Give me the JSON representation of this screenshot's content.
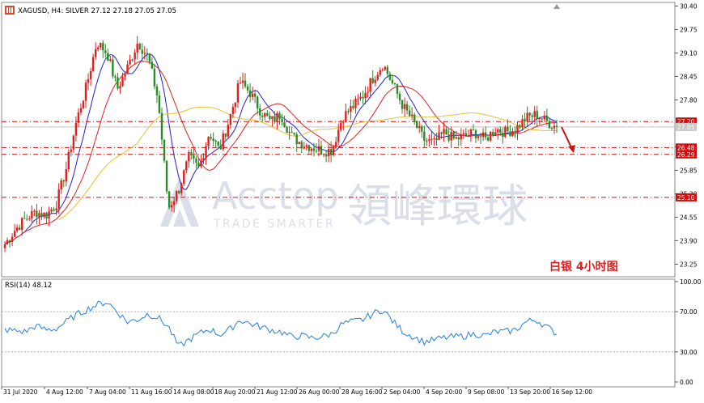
{
  "header": {
    "symbol_line": "XAGUSD, H4:  SILVER  27.12 27.18 27.05 27.05"
  },
  "rsi_header": {
    "label": "RSI(14) 48.12"
  },
  "watermark": {
    "brand": "Acctop",
    "chinese": "領峰環球",
    "tagline": "TRADE SMARTER"
  },
  "annotation": {
    "text": "白银   4小时图",
    "color": "#e02020"
  },
  "colors": {
    "bull": "#e02020",
    "bear": "#2a8a2a",
    "ma_fast": "#2020d0",
    "ma_mid": "#e02020",
    "ma_slow": "#e8c030",
    "level_line": "#d01010",
    "rsi_line": "#2080e0",
    "price_bg": "#d01010"
  },
  "chart_data": [
    {
      "type": "candlestick",
      "ylim": [
        22.9,
        30.5
      ],
      "y_ticks": [
        30.4,
        29.75,
        29.1,
        28.45,
        27.8,
        26.5,
        25.85,
        25.2,
        24.55,
        23.9,
        23.25
      ],
      "x_ticks": [
        "31 Jul 2020",
        "4 Aug 12:00",
        "7 Aug 04:00",
        "11 Aug 16:00",
        "14 Aug 08:00",
        "18 Aug 20:00",
        "21 Aug 12:00",
        "26 Aug 00:00",
        "28 Aug 16:00",
        "2 Sep 04:00",
        "4 Sep 20:00",
        "9 Sep 08:00",
        "13 Sep 20:00",
        "16 Sep 12:00"
      ],
      "levels": [
        {
          "value": 27.2,
          "label": "27.20"
        },
        {
          "value": 26.48,
          "label": "26.48"
        },
        {
          "value": 26.29,
          "label": "26.29"
        },
        {
          "value": 25.1,
          "label": "25.10"
        }
      ],
      "current_price": {
        "value": 27.05,
        "label": "27.05"
      },
      "close_path": [
        23.8,
        24.2,
        24.5,
        24.7,
        24.6,
        24.9,
        25.9,
        27.2,
        28.2,
        29.4,
        29.1,
        28.1,
        28.7,
        29.4,
        29.0,
        27.8,
        24.8,
        25.3,
        26.2,
        25.9,
        26.9,
        26.4,
        27.3,
        28.3,
        28.0,
        27.5,
        27.2,
        27.4,
        26.8,
        26.6,
        26.5,
        26.4,
        26.4,
        27.3,
        27.6,
        27.9,
        28.4,
        28.8,
        28.2,
        27.6,
        27.2,
        26.7,
        26.6,
        26.9,
        26.7,
        26.8,
        26.9,
        26.7,
        27.0,
        26.9,
        27.0,
        27.3,
        27.4,
        27.2,
        27.05
      ],
      "projection": {
        "from": 27.05,
        "to": 26.35
      }
    },
    {
      "type": "line",
      "title": "RSI(14) 48.12",
      "ylim": [
        0,
        100
      ],
      "y_ticks": [
        100.0,
        70.0,
        30.0,
        0.0
      ],
      "levels": [
        70,
        30
      ],
      "series": [
        {
          "values": [
            52,
            51,
            50,
            56,
            52,
            53,
            60,
            67,
            72,
            77,
            80,
            70,
            60,
            62,
            68,
            64,
            55,
            35,
            42,
            48,
            53,
            47,
            52,
            62,
            58,
            55,
            52,
            50,
            45,
            46,
            44,
            45,
            48,
            58,
            60,
            62,
            68,
            72,
            60,
            50,
            45,
            40,
            42,
            44,
            45,
            46,
            48,
            46,
            50,
            50,
            52,
            60,
            62,
            55,
            48
          ]
        }
      ]
    }
  ]
}
